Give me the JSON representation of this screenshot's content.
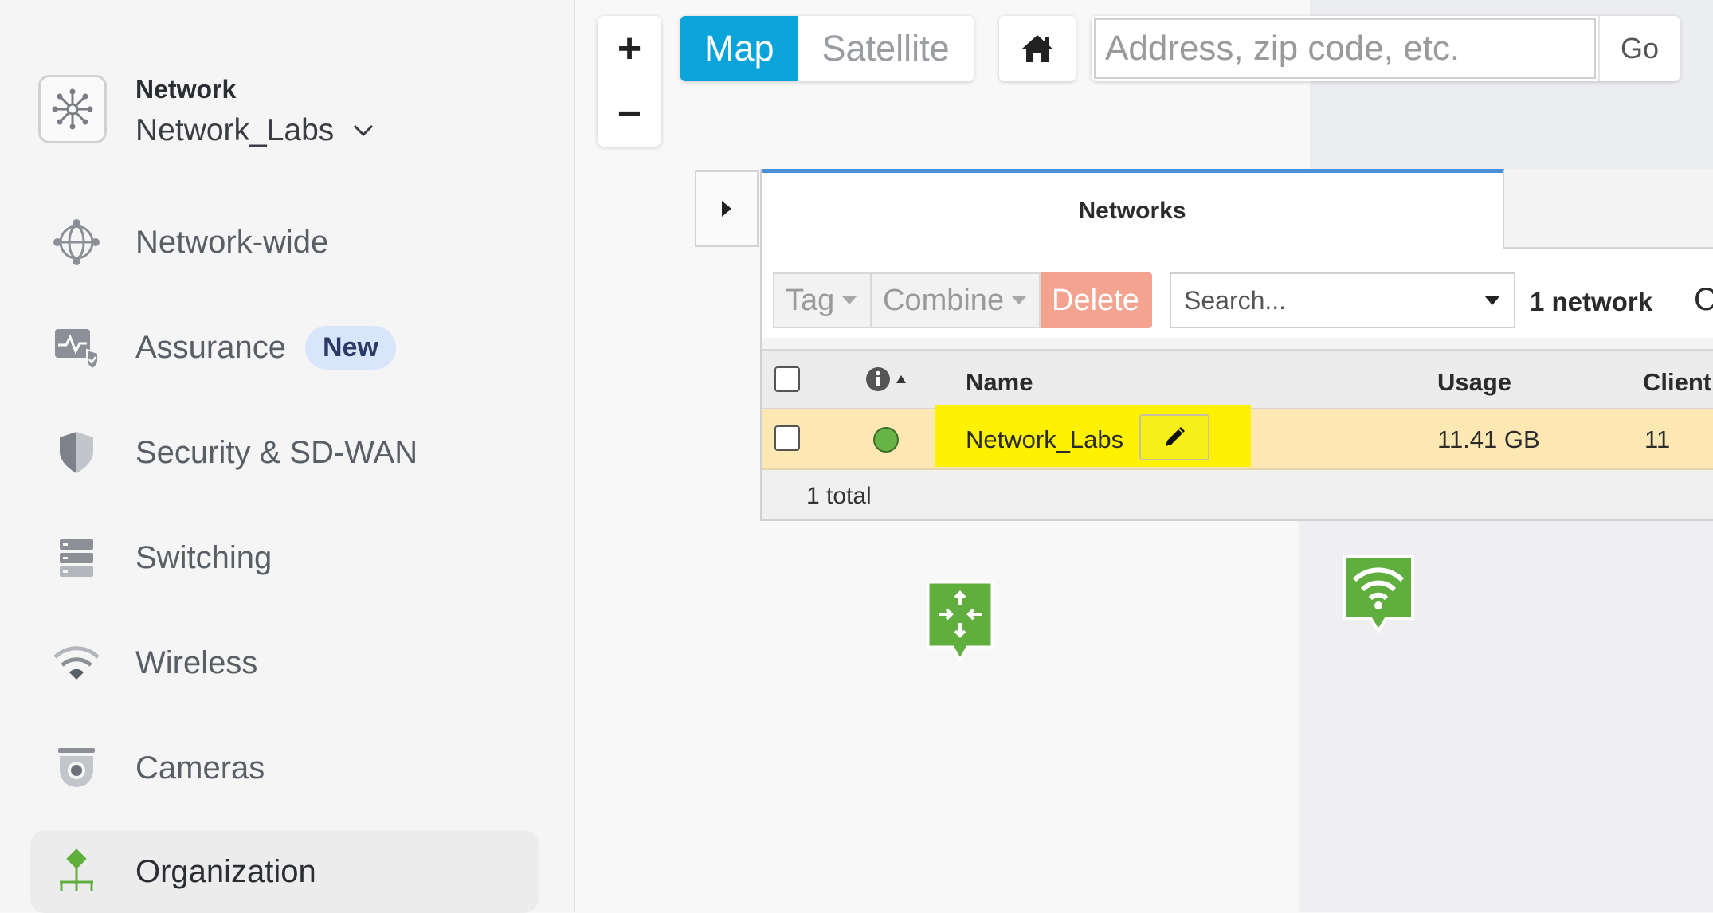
{
  "sidebar": {
    "network_caption": "Network",
    "network_name": "Network_Labs",
    "items": [
      {
        "label": "Network-wide",
        "icon": "globe-icon"
      },
      {
        "label": "Assurance",
        "icon": "assurance-icon",
        "badge": "New"
      },
      {
        "label": "Security & SD-WAN",
        "icon": "shield-icon"
      },
      {
        "label": "Switching",
        "icon": "switch-icon"
      },
      {
        "label": "Wireless",
        "icon": "wifi-icon"
      },
      {
        "label": "Cameras",
        "icon": "camera-icon"
      },
      {
        "label": "Organization",
        "icon": "organization-icon",
        "active": true,
        "highlighted": true
      }
    ]
  },
  "map": {
    "zoom_in": "+",
    "zoom_out": "−",
    "map_type": {
      "map": "Map",
      "satellite": "Satellite",
      "selected": "Map"
    },
    "address_placeholder": "Address, zip code, etc.",
    "go_label": "Go"
  },
  "networks_panel": {
    "tab_label": "Networks",
    "toolbar": {
      "tag": "Tag",
      "combine": "Combine",
      "delete": "Delete",
      "search_placeholder": "Search...",
      "count": "1 network",
      "count_cut": "C"
    },
    "columns": {
      "name": "Name",
      "usage": "Usage",
      "clients": "Client"
    },
    "rows": [
      {
        "name": "Network_Labs",
        "usage": "11.41 GB",
        "clients": "11",
        "status": "online"
      }
    ],
    "footer": "1 total"
  },
  "colors": {
    "accent": "#0aa4da",
    "highlight": "#fff200",
    "status_online": "#67b346",
    "delete": "#f4a391",
    "map_pin": "#5fae3e"
  }
}
